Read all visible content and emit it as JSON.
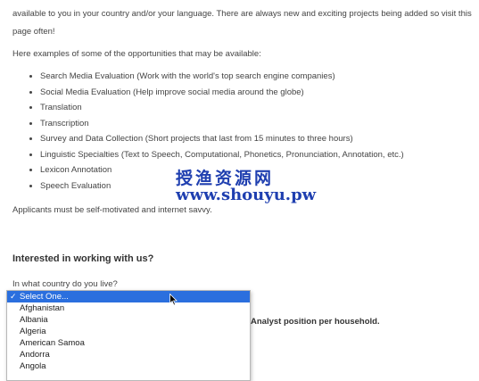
{
  "intro": "available to you in your country and/or your language. There are always new and exciting projects being added so visit this page often!",
  "lead": "Here examples of some of the opportunities that may be available:",
  "opportunities": [
    "Search Media Evaluation (Work with the world's top search engine companies)",
    "Social Media Evaluation (Help improve social media around the globe)",
    "Translation",
    "Transcription",
    "Survey and Data Collection (Short projects that last from 15 minutes to three hours)",
    "Linguistic Specialties (Text to Speech, Computational, Phonetics, Pronunciation, Annotation, etc.)",
    "Lexicon Annotation",
    "Speech Evaluation"
  ],
  "applicants": "Applicants must be self-motivated and internet savvy.",
  "form": {
    "heading": "Interested in working with us?",
    "country_question": "In what country do you live?",
    "country_options": [
      "Select One...",
      "Afghanistan",
      "Albania",
      "Algeria",
      "American Samoa",
      "Andorra",
      "Angola"
    ],
    "selected_index": 0,
    "analyst_note": "Analyst position per household."
  },
  "watermark": {
    "line1": "授渔资源网",
    "line2": "www.shouyu.pw"
  }
}
